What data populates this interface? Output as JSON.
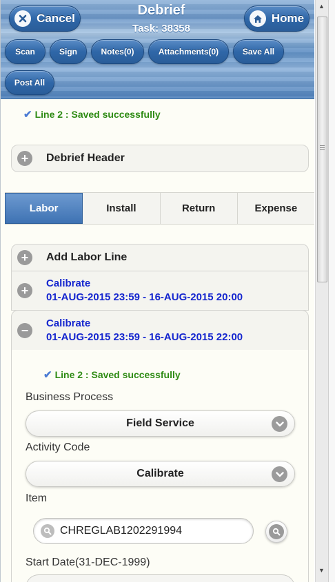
{
  "header": {
    "title": "Debrief",
    "task": "Task: 38358",
    "cancel_label": "Cancel",
    "home_label": "Home"
  },
  "toolbar": {
    "scan": "Scan",
    "sign": "Sign",
    "notes": "Notes(0)",
    "attachments": "Attachments(0)",
    "save_all": "Save All",
    "post_all": "Post All"
  },
  "top_message": "Line 2 : Saved successfully",
  "debrief_header": "Debrief Header",
  "tabs": [
    "Labor",
    "Install",
    "Return",
    "Expense"
  ],
  "active_tab": "Labor",
  "labor": {
    "add_line": "Add Labor Line",
    "lines": [
      {
        "activity": "Calibrate",
        "range": "01-AUG-2015 23:59 - 16-AUG-2015 20:00",
        "expanded": false
      },
      {
        "activity": "Calibrate",
        "range": "01-AUG-2015 23:59 - 16-AUG-2015 22:00",
        "expanded": true
      }
    ]
  },
  "form": {
    "message": "Line 2 : Saved successfully",
    "business_process_label": "Business Process",
    "business_process_value": "Field Service",
    "activity_code_label": "Activity Code",
    "activity_code_value": "Calibrate",
    "item_label": "Item",
    "item_value": "CHREGLAB1202291994",
    "start_date_label": "Start Date(31-DEC-1999)"
  },
  "colors": {
    "header_blue": "#4f81bb",
    "active_tab": "#3e72b3",
    "success_green": "#2e8b14",
    "link_blue": "#1526cf"
  },
  "icons": [
    "cancel-x-icon",
    "home-icon",
    "check-icon",
    "plus-icon",
    "minus-icon",
    "chevron-down-icon",
    "search-icon"
  ]
}
